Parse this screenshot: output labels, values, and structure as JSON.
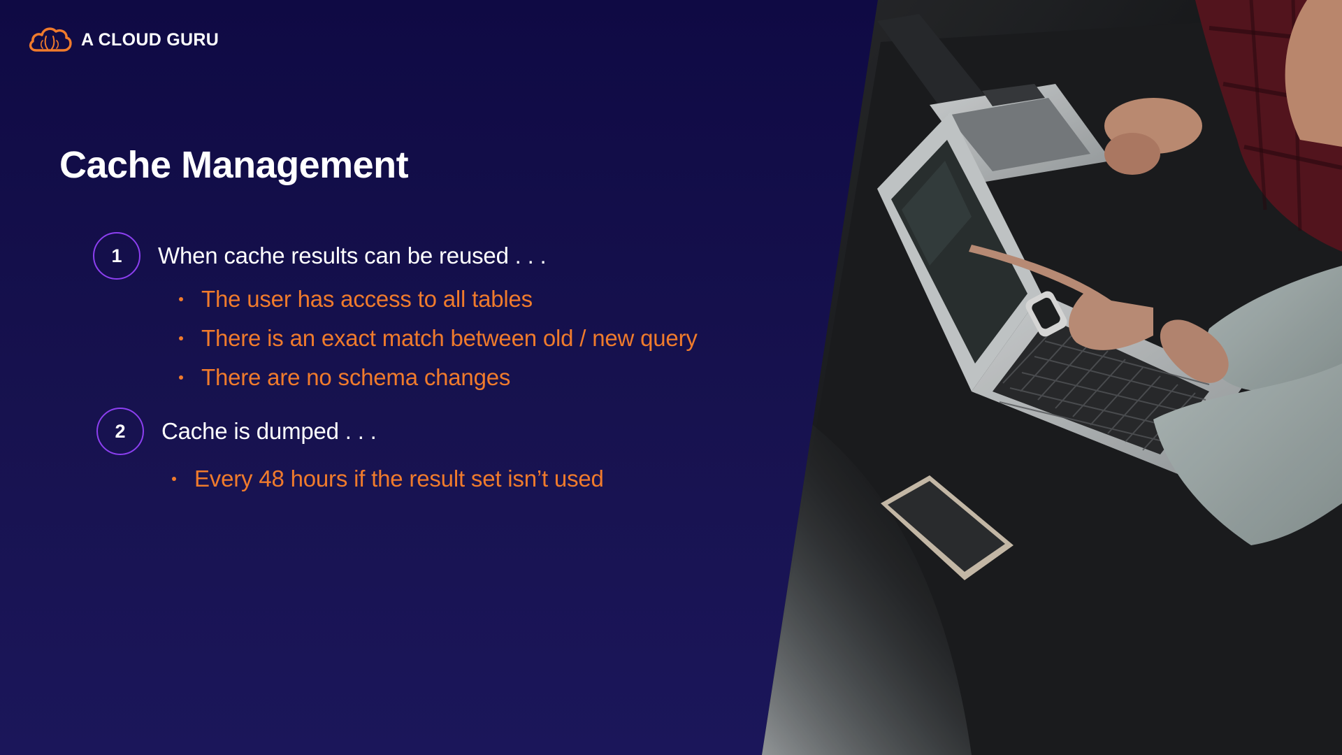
{
  "brand": {
    "logo_text": "A CLOUD GURU",
    "logo_icon": "cloud-icon",
    "accent_color": "#f07b2c"
  },
  "slide": {
    "title": "Cache Management",
    "background_color": "#140f4a",
    "number_ring_color": "#8c3ff0",
    "sections": [
      {
        "number": "1",
        "heading": "When cache results can be reused . . .",
        "bullets": [
          "The user has access to all tables",
          "There is an exact match between old / new query",
          "There are no schema changes"
        ]
      },
      {
        "number": "2",
        "heading": "Cache is dumped . . .",
        "bullets": [
          "Every 48 hours if the result set isn’t used"
        ]
      }
    ]
  }
}
